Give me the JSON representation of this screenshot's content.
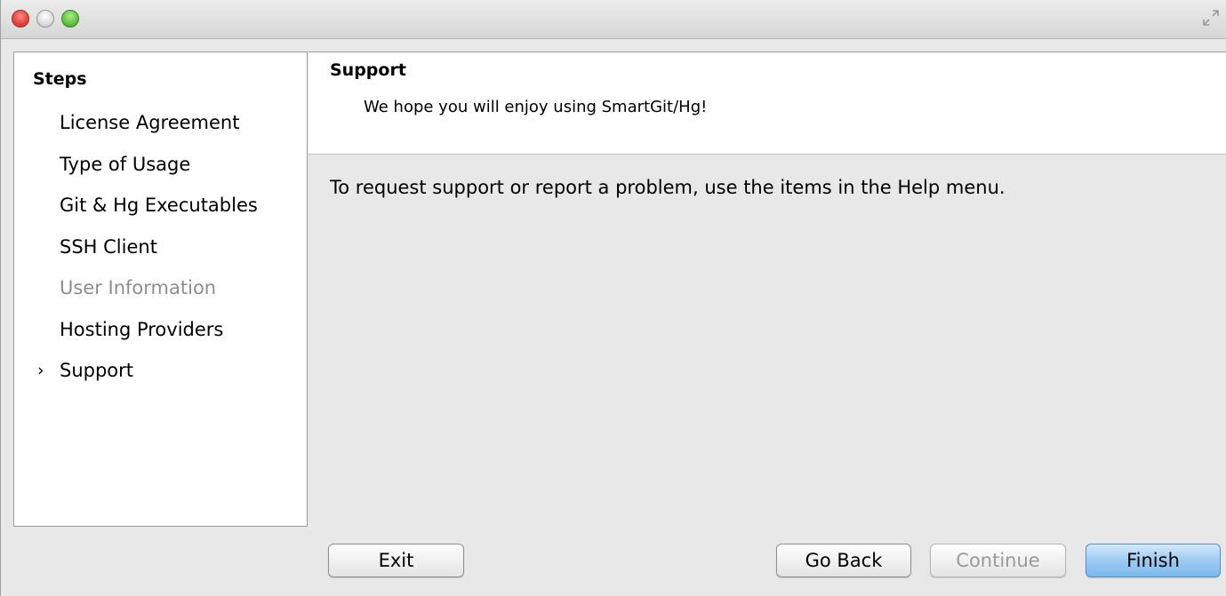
{
  "window": {
    "controls": {
      "close_icon": "close-icon",
      "minimize_icon": "minimize-icon",
      "zoom_icon": "zoom-icon",
      "fullscreen_icon": "fullscreen-icon"
    }
  },
  "sidebar": {
    "title": "Steps",
    "current_marker": "›",
    "steps": [
      {
        "label": "License Agreement",
        "state": "enabled"
      },
      {
        "label": "Type of Usage",
        "state": "enabled"
      },
      {
        "label": "Git & Hg Executables",
        "state": "enabled"
      },
      {
        "label": "SSH Client",
        "state": "enabled"
      },
      {
        "label": "User Information",
        "state": "disabled"
      },
      {
        "label": "Hosting Providers",
        "state": "enabled"
      },
      {
        "label": "Support",
        "state": "current"
      }
    ]
  },
  "header": {
    "title": "Support",
    "subtitle": "We hope you will enjoy using SmartGit/Hg!"
  },
  "content": {
    "text": "To request support or report a problem, use the items in the Help menu."
  },
  "buttons": {
    "exit": "Exit",
    "go_back": "Go Back",
    "continue": "Continue",
    "finish": "Finish"
  },
  "colors": {
    "finish_accent": "#9ccbf3",
    "disabled_text": "#8e8e8e"
  }
}
